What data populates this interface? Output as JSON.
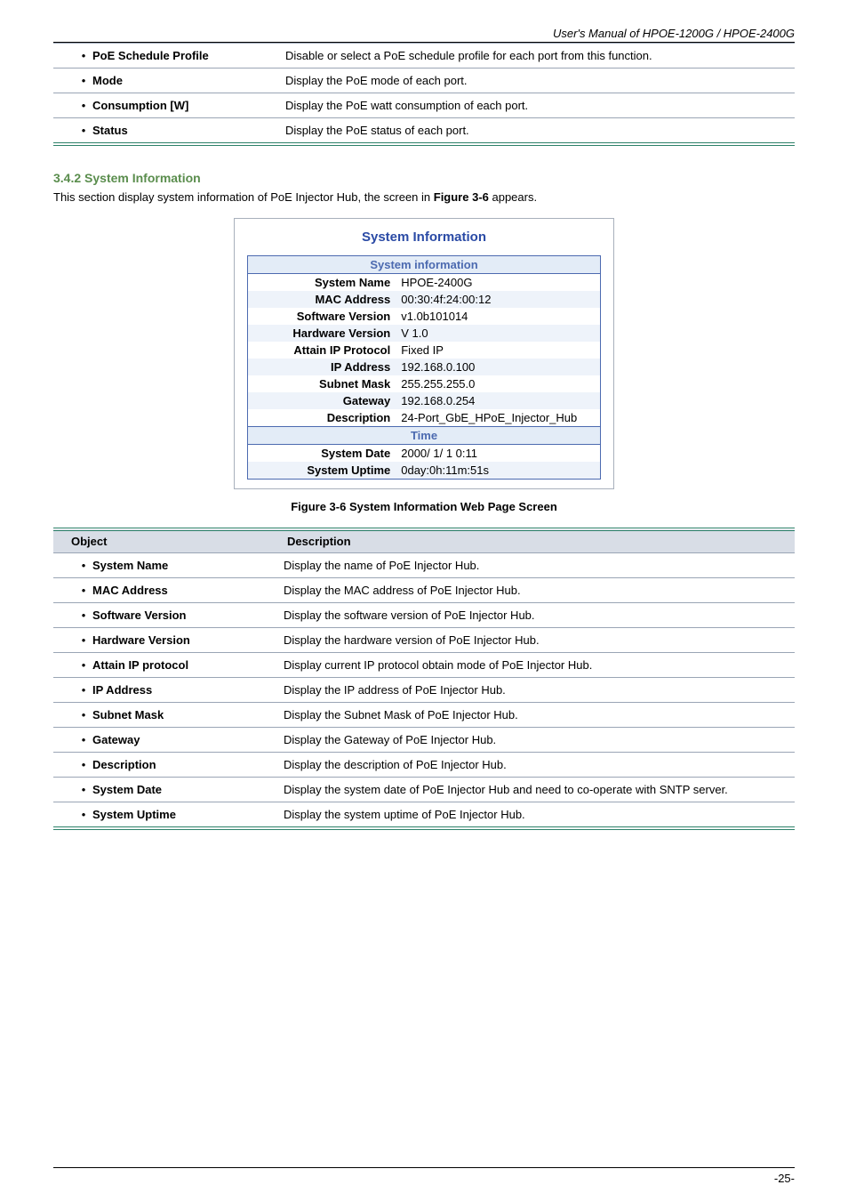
{
  "manual_header": "User's Manual of HPOE-1200G / HPOE-2400G",
  "top_table": [
    {
      "label": "PoE Schedule  Profile",
      "desc": "Disable or select a PoE schedule profile for each port from this function."
    },
    {
      "label": "Mode",
      "desc": "Display the PoE mode of each port."
    },
    {
      "label": "Consumption  [W]",
      "desc": "Display the PoE watt consumption of each port."
    },
    {
      "label": "Status",
      "desc": "Display the PoE status of each port."
    }
  ],
  "section_heading": "3.4.2 System Information",
  "section_desc_prefix": "This section display system information of PoE Injector Hub, the screen in ",
  "section_desc_figref": "Figure 3-6",
  "section_desc_suffix": " appears.",
  "panel": {
    "title": "System Information",
    "groups": [
      {
        "header": "System information",
        "rows": [
          {
            "k": "System Name",
            "v": "HPOE-2400G"
          },
          {
            "k": "MAC Address",
            "v": "00:30:4f:24:00:12"
          },
          {
            "k": "Software Version",
            "v": "v1.0b101014"
          },
          {
            "k": "Hardware Version",
            "v": "V 1.0"
          },
          {
            "k": "Attain IP Protocol",
            "v": "Fixed IP"
          },
          {
            "k": "IP Address",
            "v": "192.168.0.100"
          },
          {
            "k": "Subnet Mask",
            "v": "255.255.255.0"
          },
          {
            "k": "Gateway",
            "v": "192.168.0.254"
          },
          {
            "k": "Description",
            "v": "24-Port_GbE_HPoE_Injector_Hub"
          }
        ]
      },
      {
        "header": "Time",
        "rows": [
          {
            "k": "System Date",
            "v": "2000/ 1/ 1 0:11"
          },
          {
            "k": "System Uptime",
            "v": "0day:0h:11m:51s"
          }
        ]
      }
    ]
  },
  "figure_caption_prefix": "Figure 3-6",
  "figure_caption_text": " System Information Web Page Screen",
  "object_col": "Object",
  "desc_col": "Description",
  "def_table": [
    {
      "label": "System Name",
      "desc": "Display the name of PoE Injector Hub."
    },
    {
      "label": "MAC Address",
      "desc": "Display the MAC address of PoE Injector Hub."
    },
    {
      "label": "Software Version",
      "desc": "Display the software version of PoE Injector Hub."
    },
    {
      "label": "Hardware Version",
      "desc": "Display the hardware version of PoE Injector Hub."
    },
    {
      "label": "Attain IP protocol",
      "desc": "Display current IP protocol obtain mode of PoE Injector Hub."
    },
    {
      "label": "IP Address",
      "desc": "Display the IP address of PoE Injector Hub."
    },
    {
      "label": "Subnet Mask",
      "desc": "Display the Subnet Mask of PoE Injector Hub."
    },
    {
      "label": "Gateway",
      "desc": "Display the Gateway of PoE Injector Hub."
    },
    {
      "label": "Description",
      "desc": "Display the description of PoE Injector Hub."
    },
    {
      "label": "System Date",
      "desc": "Display the system date of PoE Injector Hub and need to co-operate with SNTP server."
    },
    {
      "label": "System Uptime",
      "desc": "Display the system uptime of PoE Injector Hub."
    }
  ],
  "footer_page": "-25-"
}
